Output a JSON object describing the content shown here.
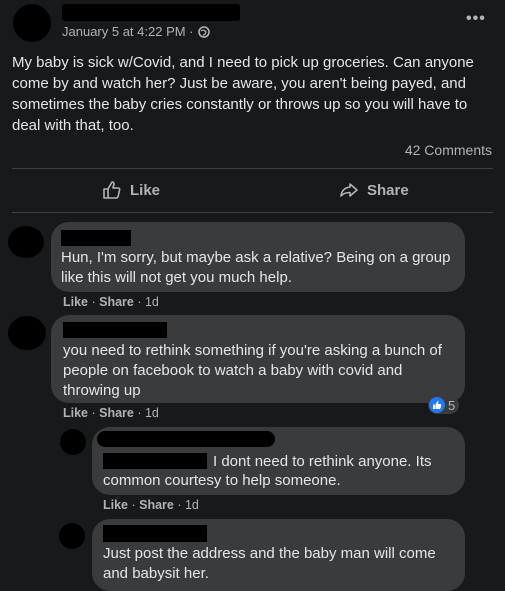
{
  "post": {
    "timestamp": "January 5 at 4:22 PM ·",
    "text": "My baby is sick w/Covid, and I need to pick up groceries. Can anyone come by and watch her? Just be aware, you aren't being payed, and sometimes the baby cries constantly or throws up so you will have to deal with that, too.",
    "comment_count": "42 Comments",
    "more_icon": "ellipsis-icon",
    "privacy_icon": "globe-icon"
  },
  "actions": {
    "like_label": "Like",
    "share_label": "Share"
  },
  "comments": [
    {
      "text": "Hun, I'm sorry, but maybe ask a relative? Being on a group like this will not get you much help.",
      "like": "Like",
      "share": "Share",
      "age": "1d"
    },
    {
      "text": "you need to rethink something if you're asking a bunch of people on facebook to watch a baby with covid and throwing up",
      "like": "Like",
      "share": "Share",
      "age": "1d",
      "reactions": "5"
    },
    {
      "text_line1": "I dont need to rethink anyone. Its",
      "text_line2": "common courtesy to help someone.",
      "like": "Like",
      "share": "Share",
      "age": "1d"
    },
    {
      "text": "Just post the address and the baby man will come and babysit her."
    }
  ],
  "colors": {
    "background": "#18191a",
    "bubble": "#3a3b3c",
    "like_reaction": "#2078f4"
  }
}
